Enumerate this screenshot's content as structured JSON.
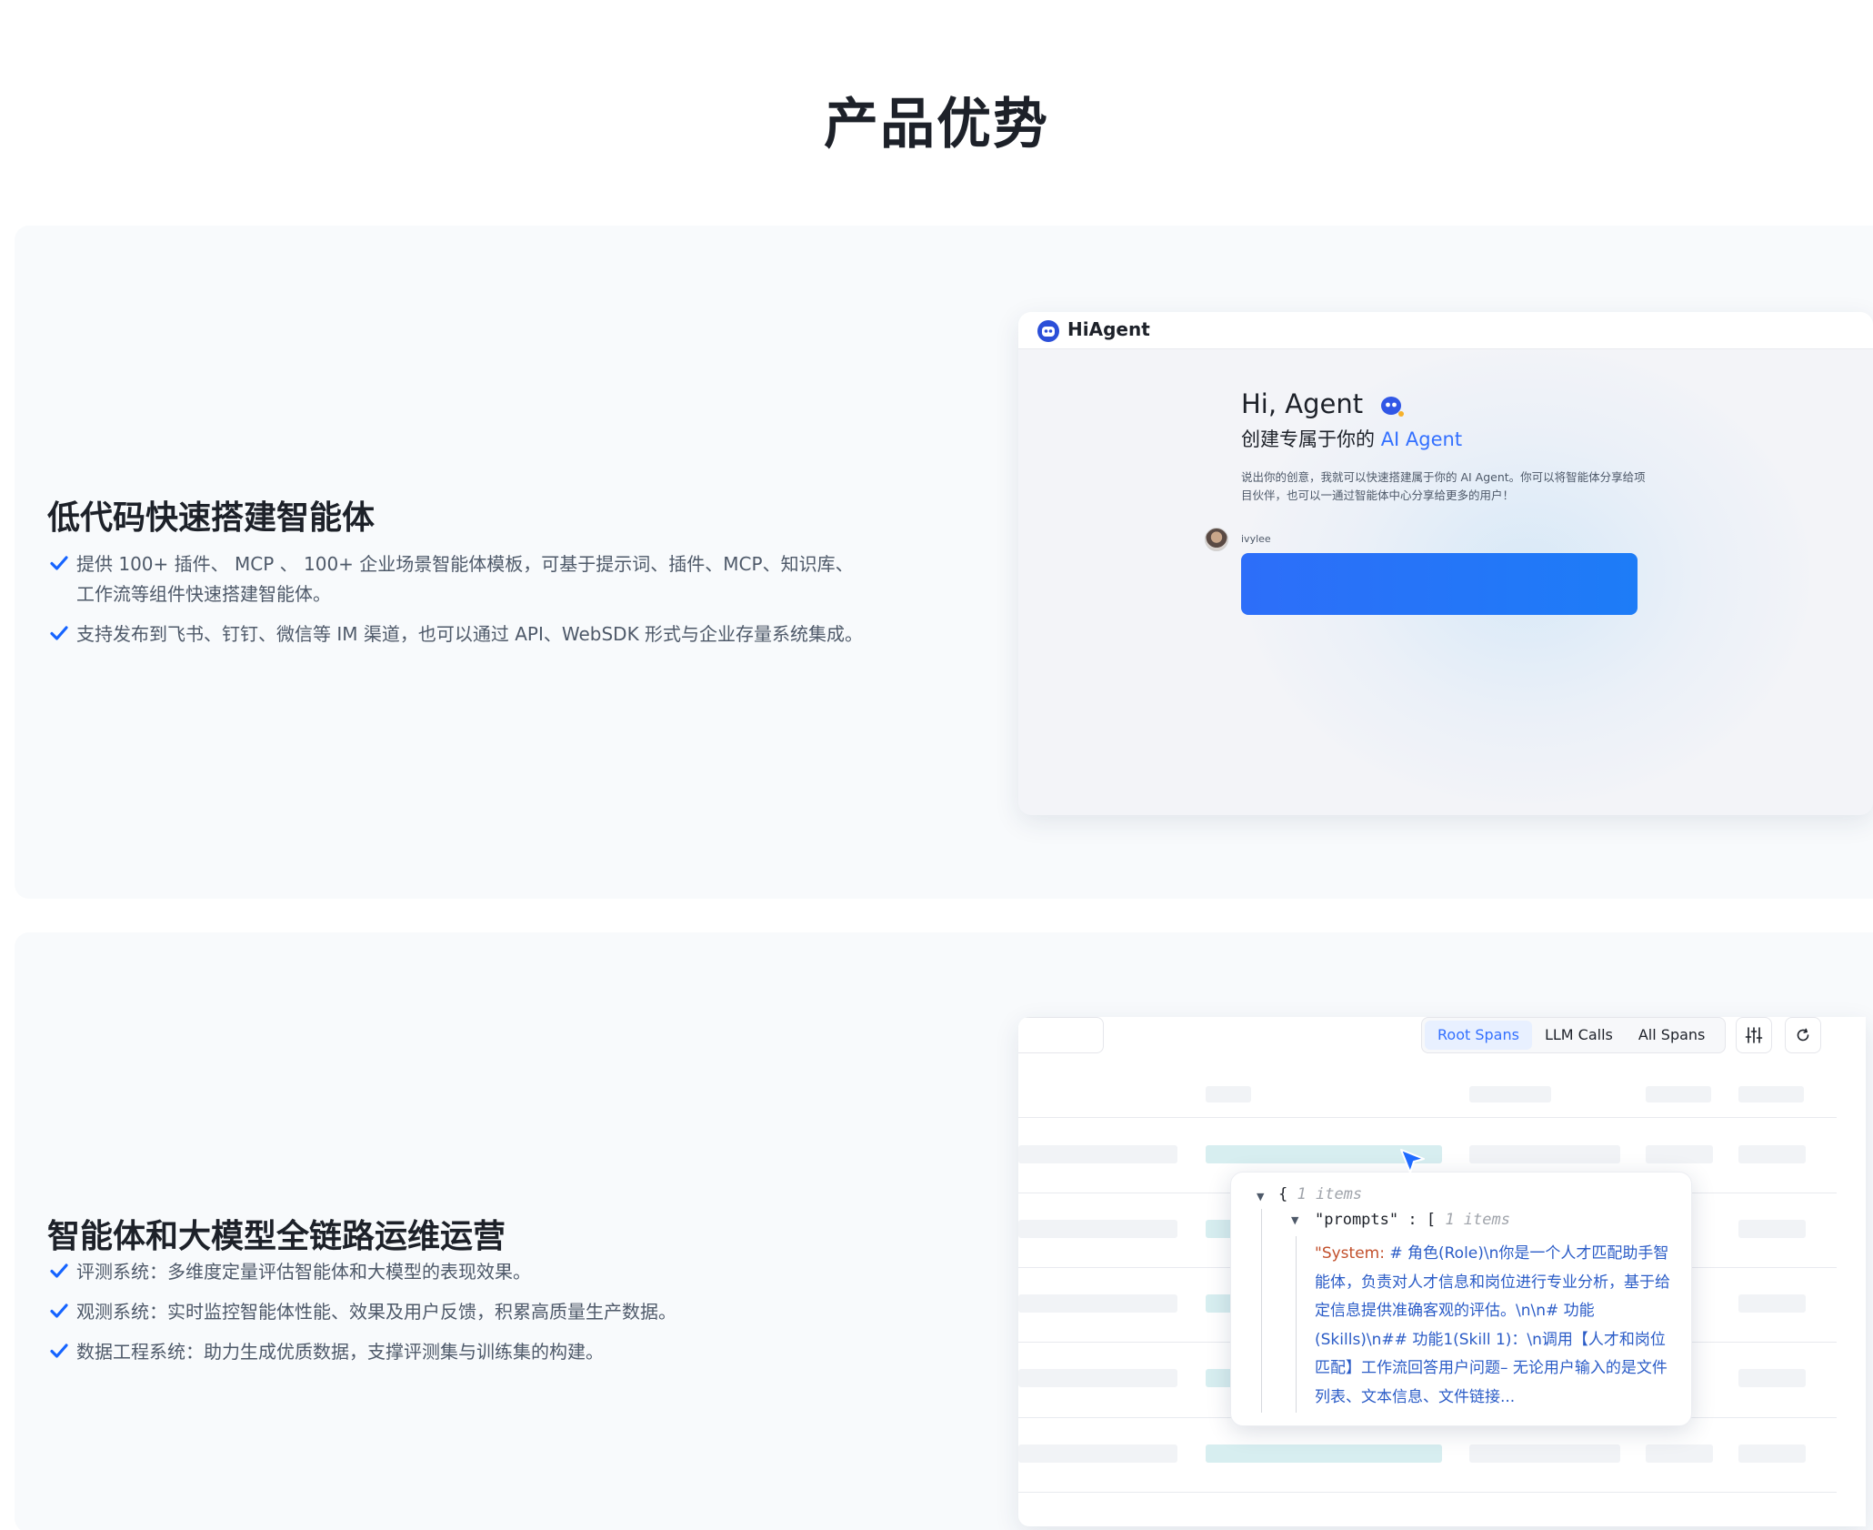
{
  "page": {
    "title": "产品优势"
  },
  "colors": {
    "accent": "#3370ff",
    "check": "#1664ff",
    "bubble": "#2d6ef9",
    "teal_placeholder": "#d7eef0"
  },
  "sections": [
    {
      "title": "低代码快速搭建智能体",
      "bullets": [
        "提供 100+ 插件、 MCP 、 100+ 企业场景智能体模板，可基于提示词、插件、MCP、知识库、工作流等组件快速搭建智能体。",
        "支持发布到飞书、钉钉、微信等 IM 渠道，也可以通过 API、WebSDK 形式与企业存量系统集成。"
      ],
      "preview": {
        "app_name": "HiAgent",
        "greeting": "Hi, Agent",
        "subtitle_prefix": "创建专属于你的 ",
        "subtitle_accent": "AI Agent",
        "description": "说出你的创意，我就可以快速搭建属于你的 AI Agent。你可以将智能体分享给项目伙伴，也可以一通过智能体中心分享给更多的用户！",
        "username": "ivylee",
        "icons": {
          "logo": "robot-logo-icon",
          "greeting": "robot-emoji-icon",
          "avatar": "user-avatar"
        }
      }
    },
    {
      "title": "智能体和大模型全链路运维运营",
      "bullets": [
        "评测系统：多维度定量评估智能体和大模型的表现效果。",
        "观测系统：实时监控智能体性能、效果及用户反馈，积累高质量生产数据。",
        "数据工程系统：助力生成优质数据，支撑评测集与训练集的构建。"
      ],
      "preview": {
        "tabs": [
          {
            "label": "Root Spans",
            "active": true
          },
          {
            "label": "LLM Calls",
            "active": false
          },
          {
            "label": "All Spans",
            "active": false
          }
        ],
        "icons": {
          "filter": "sliders-icon",
          "refresh": "refresh-icon",
          "pointer": "cursor-icon"
        },
        "json": {
          "root_open": "{",
          "root_count": "1 items",
          "key": "\"prompts\" : [",
          "key_count": "1 items",
          "value_quote": "\"System:",
          "value_text": " # 角色(Role)\\n你是一个人才匹配助手智能体，负责对人才信息和岗位进行专业分析，基于给定信息提供准确客观的评估。\\n\\n# 功能(Skills)\\n## 功能1(Skill 1)：\\n调用【人才和岗位匹配】工作流回答用户问题– 无论用户输入的是文件列表、文本信息、文件链接..."
        }
      }
    }
  ]
}
